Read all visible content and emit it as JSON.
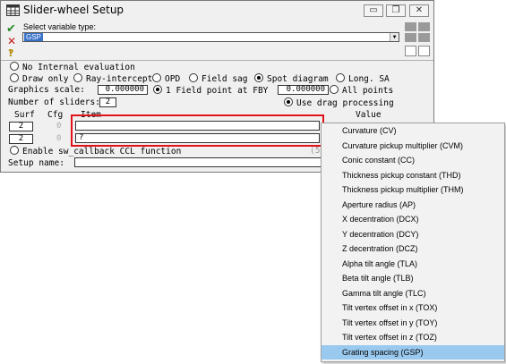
{
  "window": {
    "title": "Slider-wheel Setup",
    "controls": {
      "minimize": "▭",
      "restore": "❐",
      "close": "✕"
    }
  },
  "toolbar": {
    "ok_icon": "✔",
    "cancel_icon": "✕",
    "help_icon": "‽"
  },
  "variable_type": {
    "label": "Select variable type:",
    "value": "GSP"
  },
  "evaluation": {
    "none_label": "No Internal evaluation",
    "options": [
      {
        "label": "Draw only",
        "selected": false
      },
      {
        "label": "Ray-intercept",
        "selected": false
      },
      {
        "label": "OPD",
        "selected": false
      },
      {
        "label": "Field sag",
        "selected": false
      },
      {
        "label": "Spot diagram",
        "selected": true
      },
      {
        "label": "Long. SA",
        "selected": false
      }
    ]
  },
  "graphics_scale": {
    "label": "Graphics scale:",
    "value": "0.000000",
    "field_option": "1 Field point at FBY",
    "field_value": "0.000000",
    "all_points": "All points"
  },
  "sliders": {
    "label": "Number of sliders:",
    "value": "2",
    "drag_label": "Use drag processing"
  },
  "columns": {
    "surf": "Surf",
    "cfg": "Cfg",
    "item": "Item",
    "value": "Value"
  },
  "rows": [
    {
      "surf": "2",
      "cfg": "0",
      "item": ""
    },
    {
      "surf": "2",
      "cfg": "0",
      "item": "?"
    }
  ],
  "ccl": {
    "label": "Enable sw_callback CCL function",
    "trailing": "(5"
  },
  "setup_name": {
    "label": "Setup name:",
    "value": ""
  },
  "dropdown_menu": {
    "items": [
      "Curvature (CV)",
      "Curvature pickup multiplier (CVM)",
      "Conic constant (CC)",
      "Thickness pickup constant (THD)",
      "Thickness pickup multiplier (THM)",
      "Aperture radius (AP)",
      "X decentration (DCX)",
      "Y decentration (DCY)",
      "Z decentration (DCZ)",
      "Alpha tilt angle (TLA)",
      "Beta tilt angle (TLB)",
      "Gamma tilt angle (TLC)",
      "Tilt vertex offset in x (TOX)",
      "Tilt vertex offset in y (TOY)",
      "Tilt vertex offset in z (TOZ)",
      "Grating spacing (GSP)"
    ],
    "selected_index": 15
  },
  "colors": {
    "ok": "#2a8a2a",
    "cancel": "#c01a1a",
    "highlight": "#99c9ef",
    "red_outline": "#e0131b"
  }
}
